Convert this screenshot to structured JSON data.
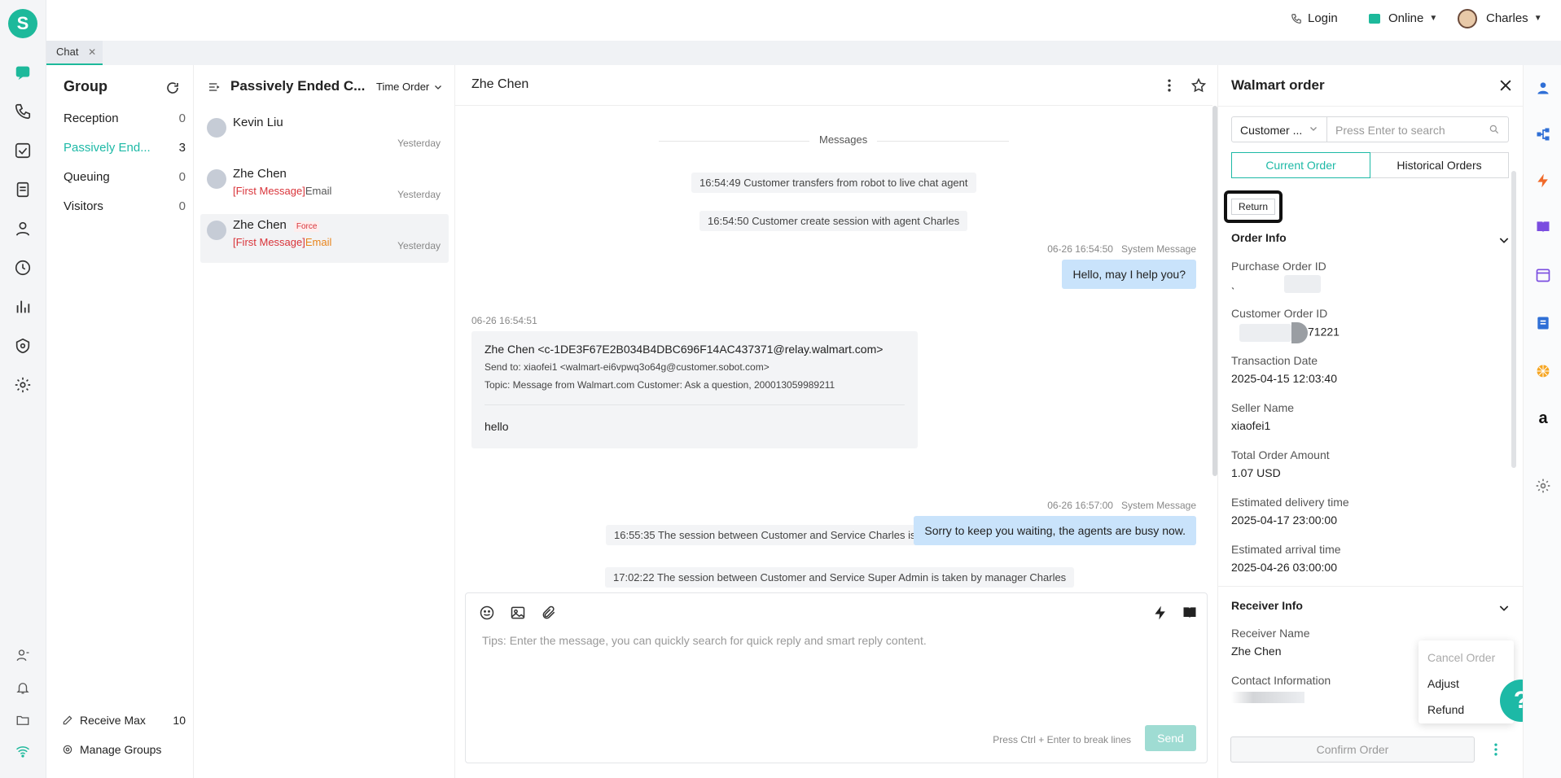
{
  "topbar": {
    "login": "Login",
    "status": "Online",
    "user": "Charles"
  },
  "tabs": [
    {
      "label": "Chat"
    }
  ],
  "group": {
    "title": "Group",
    "items": [
      {
        "label": "Reception",
        "count": "0"
      },
      {
        "label": "Passively End...",
        "count": "3"
      },
      {
        "label": "Queuing",
        "count": "0"
      },
      {
        "label": "Visitors",
        "count": "0"
      }
    ],
    "receive_max_label": "Receive Max",
    "receive_max_value": "10",
    "manage_groups": "Manage Groups"
  },
  "sessions": {
    "title": "Passively Ended C...",
    "sort": "Time Order",
    "items": [
      {
        "name": "Kevin Liu",
        "sub_red": "",
        "sub_rest": "",
        "time": "Yesterday",
        "tag": ""
      },
      {
        "name": "Zhe Chen",
        "sub_red": "[First Message]",
        "sub_rest": "Email",
        "time": "Yesterday",
        "tag": ""
      },
      {
        "name": "Zhe Chen",
        "sub_red": "[First Message]",
        "sub_rest": "Email",
        "time": "Yesterday",
        "tag": "Force"
      }
    ]
  },
  "chat": {
    "title": "Zhe Chen",
    "divider": "Messages",
    "sys1": "16:54:49 Customer transfers from robot to live chat agent",
    "sys2": "16:54:50 Customer create session with agent Charles",
    "msg1_meta_time": "06-26 16:54:50",
    "msg1_meta_sender": "System Message",
    "msg1_text": "Hello, may I help you?",
    "email_time": "06-26 16:54:51",
    "email_from": "Zhe Chen <c-1DE3F67E2B034B4DBC696F14AC437371@relay.walmart.com>",
    "email_to": "Send to: xiaofei1 <walmart-ei6vpwq3o64g@customer.sobot.com>",
    "email_topic": "Topic: Message from Walmart.com Customer:  Ask a question, 200013059989211",
    "email_body": "hello",
    "sys3": "16:55:35 The session between Customer and Service Charles is taken by manager Super Admin",
    "msg2_meta_time": "06-26 16:57:00",
    "msg2_meta_sender": "System Message",
    "msg2_text": "Sorry to keep you waiting, the agents are busy now.",
    "sys4": "17:02:22 The session between Customer and Service Super Admin is taken by manager Charles",
    "composer_placeholder": "Tips: Enter the message, you can quickly search for quick reply and smart reply content.",
    "composer_hint": "Press Ctrl + Enter to break lines",
    "send": "Send"
  },
  "order": {
    "title": "Walmart order",
    "filter": "Customer ...",
    "search_placeholder": "Press Enter to search",
    "tab_current": "Current Order",
    "tab_history": "Historical Orders",
    "return_btn": "Return",
    "order_info": "Order Info",
    "fields": [
      {
        "label": "Purchase Order ID",
        "value": "ˎ"
      },
      {
        "label": "Customer Order ID",
        "value": "71221"
      },
      {
        "label": "Transaction Date",
        "value": "2025-04-15 12:03:40"
      },
      {
        "label": "Seller Name",
        "value": "xiaofei1"
      },
      {
        "label": "Total Order Amount",
        "value": "1.07 USD"
      },
      {
        "label": "Estimated delivery time",
        "value": "2025-04-17 23:00:00"
      },
      {
        "label": "Estimated arrival time",
        "value": "2025-04-26 03:00:00"
      }
    ],
    "receiver_info": "Receiver Info",
    "receiver_name_label": "Receiver Name",
    "receiver_name": "Zhe Chen",
    "contact_label": "Contact Information",
    "menu": [
      "Cancel Order",
      "Adjust",
      "Refund"
    ],
    "confirm": "Confirm Order",
    "help": "?"
  },
  "colors": {
    "accent": "#1db99b",
    "bubble": "#c9e3fb",
    "red": "#d9343a",
    "orange": "#e8841a"
  }
}
